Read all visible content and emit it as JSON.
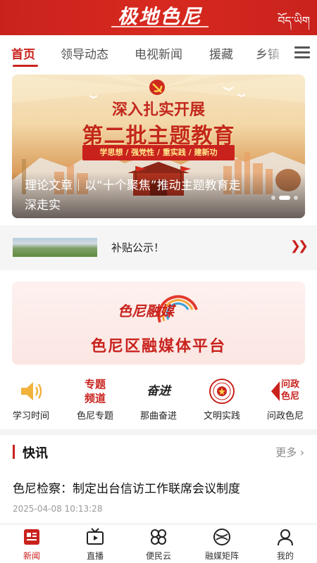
{
  "header": {
    "logo_text": "极地色尼",
    "lang_switch": "བོད་ཡིག"
  },
  "tabs": [
    {
      "label": "首页",
      "active": true
    },
    {
      "label": "领导动态"
    },
    {
      "label": "电视新闻"
    },
    {
      "label": "援藏"
    },
    {
      "label": "乡镇"
    }
  ],
  "banner": {
    "headline_small": "深入扎实开展",
    "headline_big": "第二批主题教育",
    "subline": "学思想 / 强党性 / 重实践 / 建新功",
    "caption": "理论文章｜以“十个聚焦”推动主题教育走深走实",
    "slide_count": 3,
    "active_slide": 2
  },
  "notice": {
    "text": "补贴公示！",
    "arrow": "»"
  },
  "promo": {
    "logo_text": "色尼融媒",
    "title": "色尼区融媒体平台"
  },
  "quick_links": [
    {
      "label": "学习时间",
      "icon": "speaker-icon"
    },
    {
      "label": "色尼专题",
      "icon": "special-topic-icon",
      "icon_text": [
        "专题",
        "频道"
      ]
    },
    {
      "label": "那曲奋进",
      "icon": "naqu-fenjin-icon",
      "icon_text": [
        "奋进"
      ]
    },
    {
      "label": "文明实践",
      "icon": "civilization-seal-icon"
    },
    {
      "label": "问政色尼",
      "icon": "wenzheng-icon",
      "icon_text": [
        "问政",
        "色尼"
      ]
    }
  ],
  "flash_news": {
    "title": "快讯",
    "more": "更多",
    "item": {
      "title": "色尼检察：制定出台信访工作联席会议制度",
      "time": "2025-04-08 10:13:28"
    }
  },
  "bottom_nav": [
    {
      "label": "新闻",
      "icon": "news-icon",
      "active": true
    },
    {
      "label": "直播",
      "icon": "tv-icon"
    },
    {
      "label": "便民云",
      "icon": "services-icon"
    },
    {
      "label": "融媒矩阵",
      "icon": "media-matrix-icon"
    },
    {
      "label": "我的",
      "icon": "user-icon"
    }
  ],
  "colors": {
    "brand_red": "#c9221d",
    "text": "#222222",
    "muted": "#999999"
  }
}
